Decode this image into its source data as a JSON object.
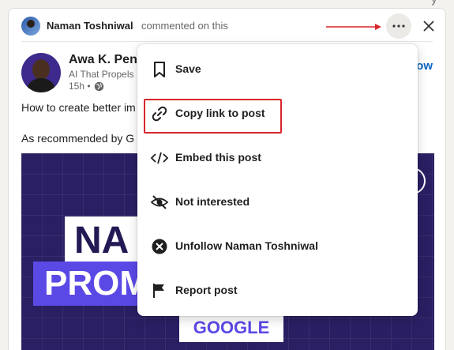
{
  "top_peek": "y",
  "header": {
    "name": "Naman Toshniwal",
    "action": "commented on this"
  },
  "author": {
    "name": "Awa K. Penn",
    "headline": "AI That Propels",
    "time": "15h •"
  },
  "follow_label": "ow",
  "post": {
    "line1": "How to create better im",
    "line2": "As recommended by G"
  },
  "image": {
    "word1": "NA",
    "word2": "PROM",
    "word3": "GOOGLE"
  },
  "menu": {
    "items": [
      {
        "label": "Save",
        "icon": "bookmark-icon"
      },
      {
        "label": "Copy link to post",
        "icon": "link-icon"
      },
      {
        "label": "Embed this post",
        "icon": "code-icon"
      },
      {
        "label": "Not interested",
        "icon": "eye-slash-icon"
      },
      {
        "label": "Unfollow Naman Toshniwal",
        "icon": "close-circle-icon"
      },
      {
        "label": "Report post",
        "icon": "flag-icon"
      }
    ]
  },
  "colors": {
    "highlight": "#d8262c",
    "accent": "#0a66c2",
    "image_bg": "#2a1f63",
    "image_purple": "#5b49e6"
  }
}
